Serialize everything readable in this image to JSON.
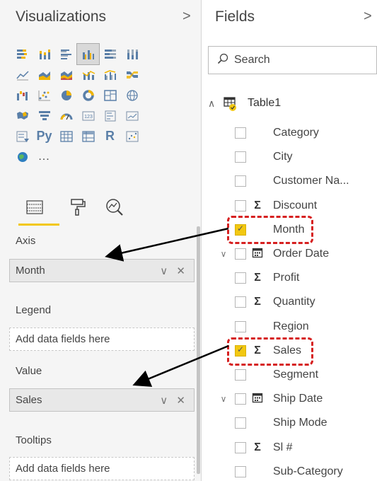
{
  "visualizations": {
    "title": "Visualizations",
    "chevron": ">",
    "icons": [
      "stacked-bar-icon",
      "stacked-column-icon",
      "clustered-bar-icon",
      "clustered-column-icon",
      "100-stacked-bar-icon",
      "100-stacked-column-icon",
      "line-chart-icon",
      "area-chart-icon",
      "stacked-area-icon",
      "line-column-icon",
      "line-clustered-column-icon",
      "ribbon-chart-icon",
      "waterfall-icon",
      "scatter-icon",
      "pie-chart-icon",
      "donut-chart-icon",
      "treemap-icon",
      "map-icon",
      "filled-map-icon",
      "funnel-icon",
      "gauge-icon",
      "card-icon",
      "multi-row-card-icon",
      "kpi-icon",
      "slicer-icon",
      "python-visual-icon",
      "table-visual-icon",
      "matrix-icon",
      "r-visual-icon",
      "decomposition-tree-icon",
      "arcgis-map-icon",
      "more-visuals-icon"
    ],
    "python_label": "Py",
    "r_label": "R",
    "more_label": "...",
    "selected_index": 3,
    "wells": {
      "axis": {
        "label": "Axis",
        "value": "Month"
      },
      "legend": {
        "label": "Legend",
        "placeholder": "Add data fields here"
      },
      "value": {
        "label": "Value",
        "value": "Sales"
      },
      "tooltips": {
        "label": "Tooltips",
        "placeholder": "Add data fields here"
      },
      "controls": "∨ ✕"
    }
  },
  "fields": {
    "title": "Fields",
    "chevron": ">",
    "search_placeholder": "Search",
    "table_name": "Table1",
    "items": [
      {
        "name": "Category",
        "checked": false,
        "kind": ""
      },
      {
        "name": "City",
        "checked": false,
        "kind": ""
      },
      {
        "name": "Customer Na...",
        "checked": false,
        "kind": ""
      },
      {
        "name": "Discount",
        "checked": false,
        "kind": "Σ"
      },
      {
        "name": "Month",
        "checked": true,
        "kind": ""
      },
      {
        "name": "Order Date",
        "checked": false,
        "kind": "calendar",
        "expandable": true
      },
      {
        "name": "Profit",
        "checked": false,
        "kind": "Σ"
      },
      {
        "name": "Quantity",
        "checked": false,
        "kind": "Σ"
      },
      {
        "name": "Region",
        "checked": false,
        "kind": ""
      },
      {
        "name": "Sales",
        "checked": true,
        "kind": "Σ"
      },
      {
        "name": "Segment",
        "checked": false,
        "kind": ""
      },
      {
        "name": "Ship Date",
        "checked": false,
        "kind": "calendar",
        "expandable": true
      },
      {
        "name": "Ship Mode",
        "checked": false,
        "kind": ""
      },
      {
        "name": "Sl #",
        "checked": false,
        "kind": "Σ"
      },
      {
        "name": "Sub-Category",
        "checked": false,
        "kind": ""
      }
    ]
  },
  "colors": {
    "accent": "#f2c811",
    "highlight": "#d62020",
    "arrow": "#000000"
  }
}
